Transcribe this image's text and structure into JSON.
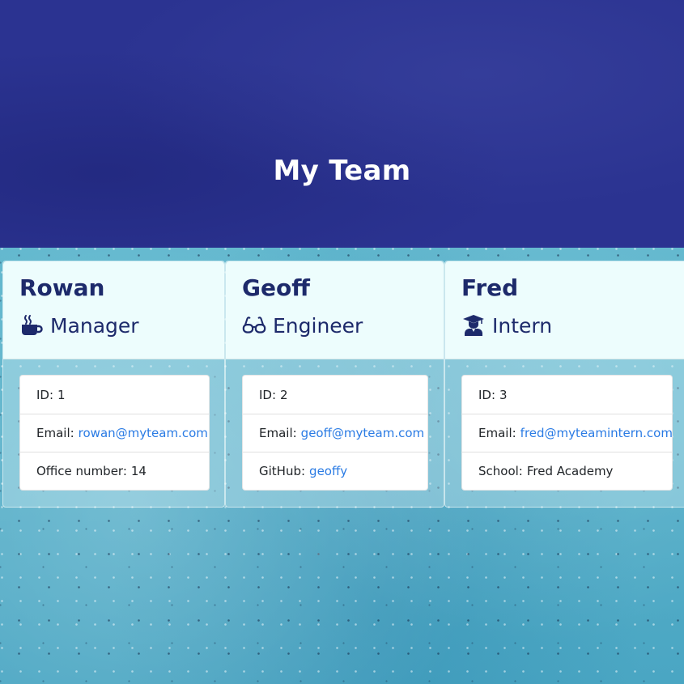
{
  "header": {
    "title": "My Team"
  },
  "colors": {
    "hero_bg": "#2b3391",
    "card_header_bg": "#edfdfd",
    "text_dark": "#1d2a6b",
    "link": "#2a7be4"
  },
  "employees": [
    {
      "name": "Rowan",
      "role": "Manager",
      "role_icon": "coffee-mug-icon",
      "id_label": "ID:",
      "id": "1",
      "email_label": "Email:",
      "email": "rowan@myteam.com",
      "extra_label": "Office number:",
      "extra_value": "14"
    },
    {
      "name": "Geoff",
      "role": "Engineer",
      "role_icon": "glasses-icon",
      "id_label": "ID:",
      "id": "2",
      "email_label": "Email:",
      "email": "geoff@myteam.com",
      "extra_label": "GitHub:",
      "extra_value": "geoffy"
    },
    {
      "name": "Fred",
      "role": "Intern",
      "role_icon": "graduate-icon",
      "id_label": "ID:",
      "id": "3",
      "email_label": "Email:",
      "email": "fred@myteamintern.com",
      "extra_label": "School:",
      "extra_value": "Fred Academy"
    }
  ]
}
